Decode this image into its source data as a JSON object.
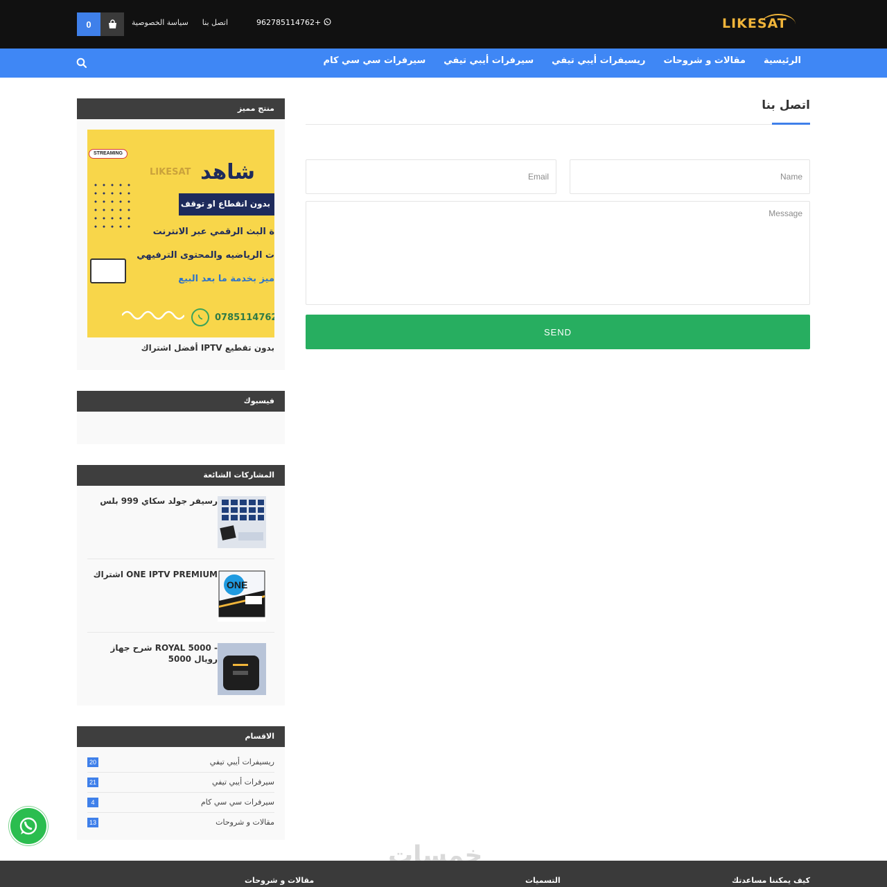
{
  "header": {
    "logo": "LIKESAT",
    "phone": "962785114762+",
    "links": [
      "اتصل بنا",
      "سياسة الخصوصية"
    ],
    "cart_count": "0"
  },
  "nav": {
    "items": [
      "الرئيسية",
      "مقالات و شروحات",
      "ريسيفرات أيبي تيفي",
      "سيرفرات أيبي تيفي",
      "سيرفرات سي سي كام"
    ]
  },
  "contact": {
    "title": "اتصل بنا",
    "name_placeholder": "Name",
    "email_placeholder": "Email",
    "message_placeholder": "Message",
    "send_label": "SEND"
  },
  "sidebar": {
    "featured": {
      "title": "منتج مميز",
      "promo_badge": "STREAMING",
      "promo_logo": "LIKESAT",
      "promo_heading": "شاهد",
      "promo_banner": "بدون انقطاع او توقف",
      "promo_line1": "ة البث الرقمي عبر الانترنت",
      "promo_line2": "ت الرياضيه والمحتوى الترفيهي",
      "promo_line3": "ميز بخدمة ما بعد البيع",
      "promo_phone": "0785114762",
      "caption": "أفضل اشتراك IPTV بدون تقطيع"
    },
    "facebook": {
      "title": "فيسبوك"
    },
    "popular": {
      "title": "المشاركات الشائعة",
      "items": [
        {
          "title": "رسيفر جولد سكاي 999 بلس",
          "thumb": "receiver-grid"
        },
        {
          "title": "اشتراك ONE IPTV PREMIUM",
          "thumb": "one-logo"
        },
        {
          "title": "شرح جهاز ROYAL 5000 - رويال 5000",
          "thumb": "royal-box"
        }
      ]
    },
    "categories": {
      "title": "الاقسام",
      "items": [
        {
          "label": "ريسيفرات أيبي تيفي",
          "count": "20"
        },
        {
          "label": "سيرفرات أيبي تيفي",
          "count": "21"
        },
        {
          "label": "سيرفرات سي سي كام",
          "count": "4"
        },
        {
          "label": "مقالات و شروحات",
          "count": "13"
        }
      ]
    }
  },
  "footer": {
    "watermark": "خمسات",
    "columns": [
      "كيف يمكننا مساعدتك",
      "التسميات",
      "مقالات و شروحات"
    ]
  },
  "colors": {
    "accent": "#3f80ea",
    "nav": "#3f87f5",
    "send": "#27ae60",
    "topbar": "#111111",
    "widget_head": "#3e3e3e",
    "whatsapp": "#2bbd4f"
  },
  "icons": [
    "whatsapp-icon",
    "shopping-bag-icon",
    "search-icon"
  ]
}
